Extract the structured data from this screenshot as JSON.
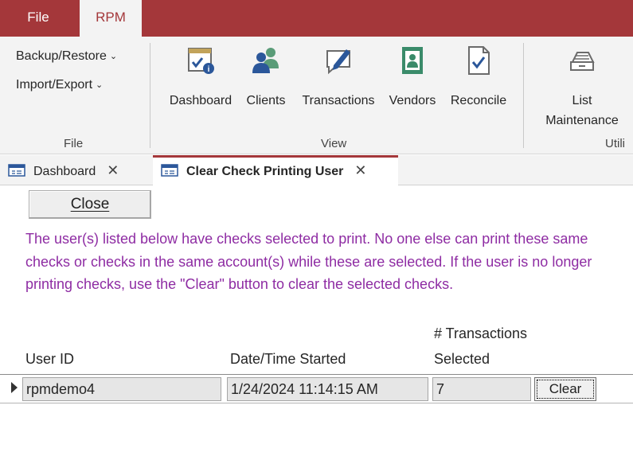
{
  "menu": {
    "file": "File",
    "rpm": "RPM"
  },
  "ribbon": {
    "file_group": {
      "backup_restore": "Backup/Restore",
      "import_export": "Import/Export",
      "label": "File"
    },
    "view_group": {
      "label": "View",
      "buttons": [
        "Dashboard",
        "Clients",
        "Transactions",
        "Vendors",
        "Reconcile"
      ]
    },
    "utilities_group": {
      "label": "Utili",
      "list_maintenance_line1": "List",
      "list_maintenance_line2": "Maintenance"
    }
  },
  "tabs": [
    {
      "label": "Dashboard"
    },
    {
      "label": "Clear Check Printing User"
    }
  ],
  "form": {
    "close_label": "Close",
    "message": "The user(s) listed below have checks selected to print. No one else can print these same checks or checks in the same account(s) while these are selected. If the user is no longer printing checks, use the \"Clear\" button to clear the selected checks.",
    "headers": {
      "user_id": "User ID",
      "date_started": "Date/Time Started",
      "transactions_line1": "# Transactions",
      "transactions_line2": "Selected"
    },
    "row": {
      "user_id": "rpmdemo4",
      "date_started": "1/24/2024 11:14:15 AM",
      "transactions": "7",
      "clear_label": "Clear"
    }
  },
  "colors": {
    "accent": "#a4373a",
    "message": "#8e2ca3",
    "icon_blue": "#2b579a",
    "icon_green": "#3a8b6a"
  }
}
